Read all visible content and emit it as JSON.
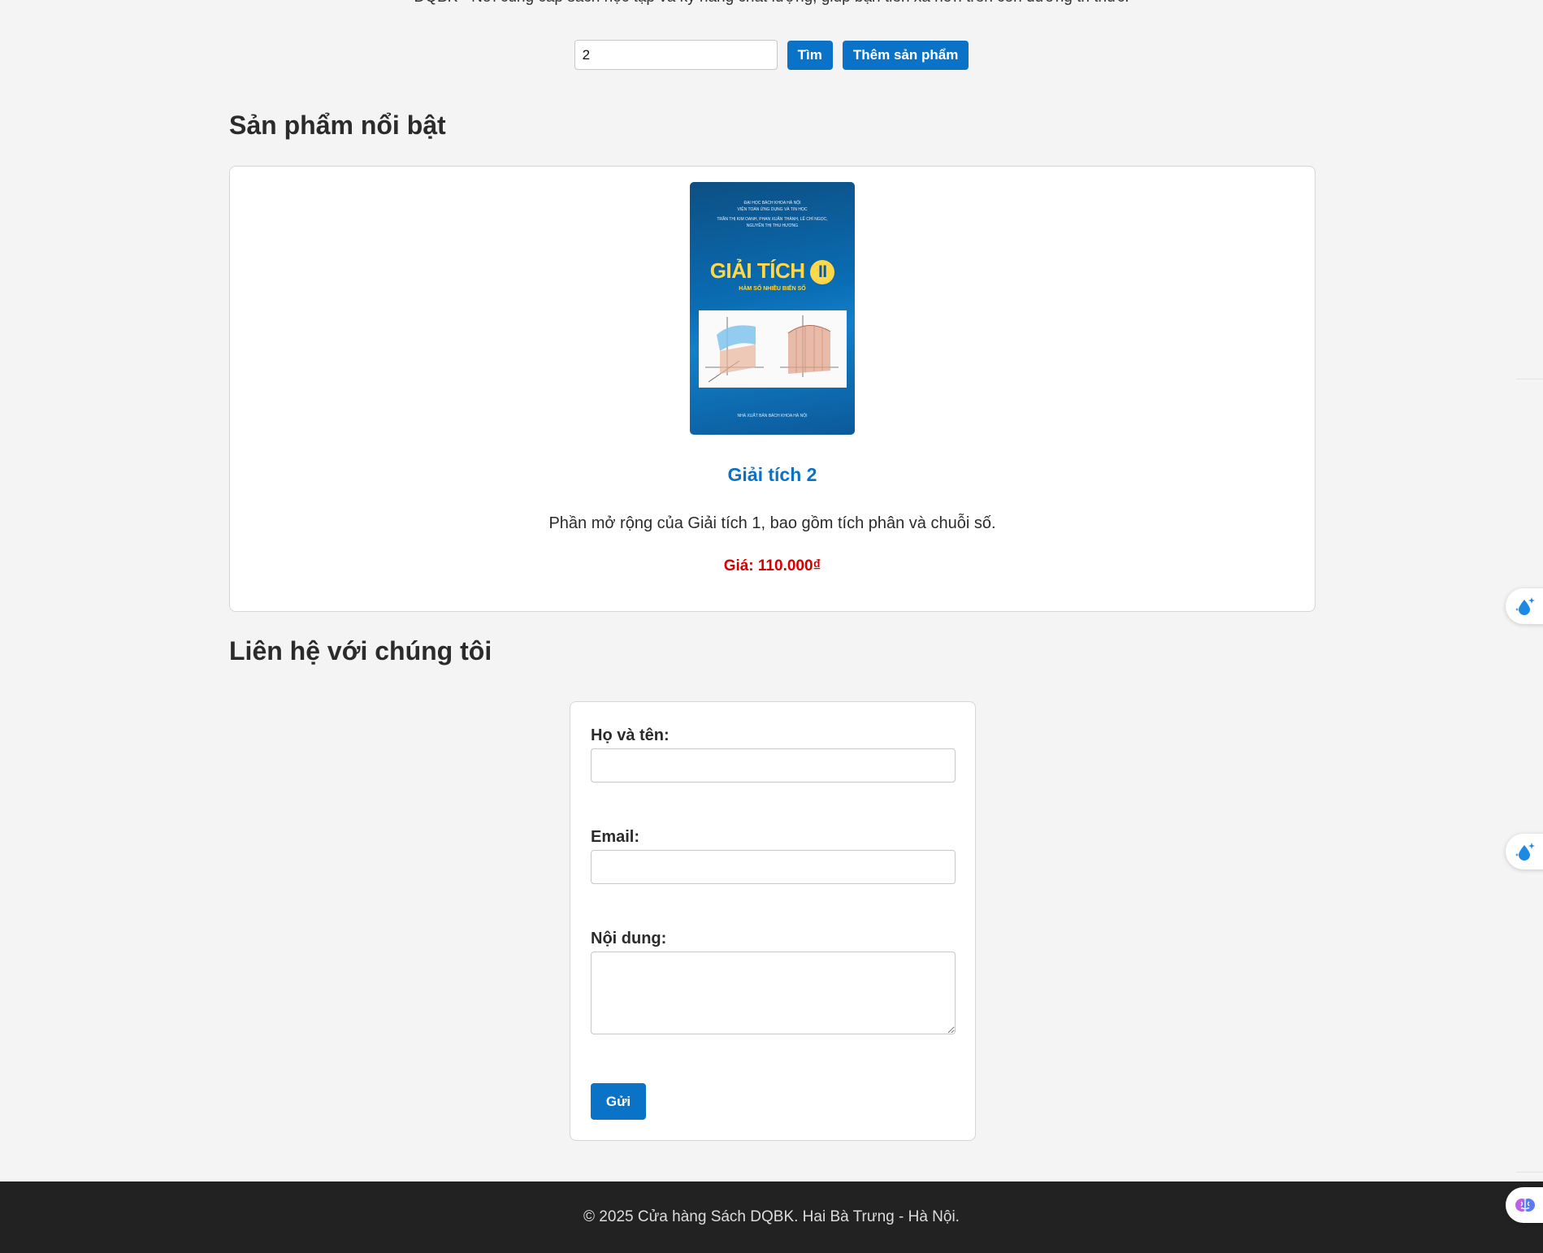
{
  "header": {
    "tagline": "DQBK - Nơi cung cấp sách học tập và kỹ năng chất lượng, giúp bạn tiến xa hơn trên con đường tri thức."
  },
  "search": {
    "value": "2",
    "search_button": "Tìm",
    "add_button": "Thêm sản phẩm"
  },
  "featured": {
    "title": "Sản phẩm nổi bật",
    "product": {
      "cover": {
        "top_lines": [
          "ĐẠI HỌC BÁCH KHOA HÀ NỘI",
          "VIỆN TOÁN ỨNG DỤNG VÀ TIN HỌC",
          "TRẦN THỊ KIM OANH, PHAN XUÂN THÀNH, LÊ CHÍ NGỌC,",
          "NGUYỄN THỊ THU HƯƠNG"
        ],
        "title": "GIẢI TÍCH",
        "volume": "II",
        "subtitle": "HÀM SỐ NHIỀU BIẾN SỐ",
        "publisher": "NHÀ XUẤT BẢN BÁCH KHOA HÀ NỘI"
      },
      "name": "Giải tích 2",
      "description": "Phần mở rộng của Giải tích 1, bao gồm tích phân và chuỗi số.",
      "price": "Giá: 110.000₫"
    }
  },
  "contact": {
    "title": "Liên hệ với chúng tôi",
    "name_label": "Họ và tên:",
    "email_label": "Email:",
    "message_label": "Nội dung:",
    "name_value": "",
    "email_value": "",
    "message_value": "",
    "submit": "Gửi"
  },
  "footer": {
    "text": "© 2025 Cửa hàng Sách DQBK. Hai Bà Trưng - Hà Nội."
  },
  "colors": {
    "accent": "#0a72c7",
    "price": "#d50000",
    "footer_bg": "#222222",
    "page_bg": "#f4f4f4"
  },
  "floating_icons": [
    "water-drop-sparkle-icon",
    "water-drop-sparkle-icon",
    "brain-icon"
  ]
}
